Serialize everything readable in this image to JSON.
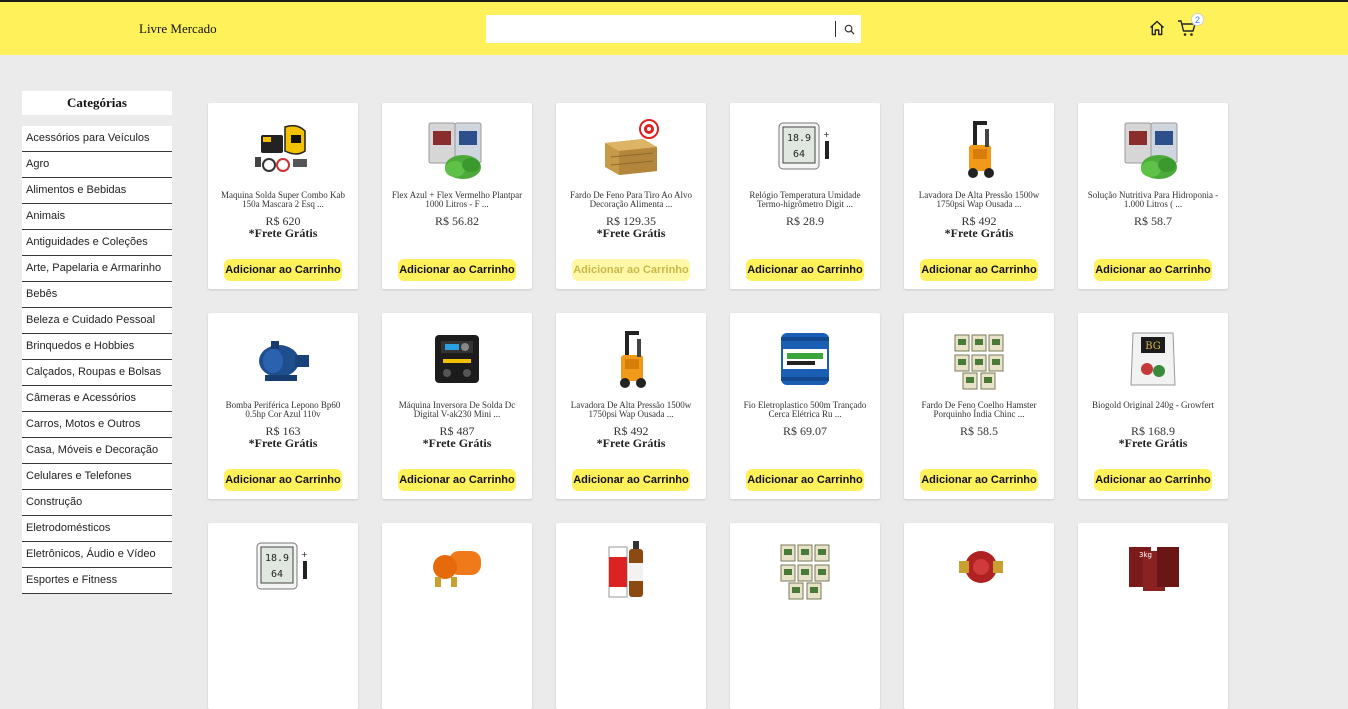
{
  "header": {
    "brand": "Livre Mercado",
    "search": {
      "value": "",
      "placeholder": ""
    },
    "cart_count": "2",
    "icons": {
      "home": "home-icon",
      "cart": "cart-icon",
      "search": "search-icon"
    },
    "colors": {
      "header_bg": "#fff159",
      "button_bg": "#fff159",
      "badge_text": "#3483fa"
    }
  },
  "sidebar": {
    "title": "Categórias",
    "items": [
      "Acessórios para Veículos",
      "Agro",
      "Alimentos e Bebidas",
      "Animais",
      "Antiguidades e Coleções",
      "Arte, Papelaria e Armarinho",
      "Bebês",
      "Beleza e Cuidado Pessoal",
      "Brinquedos e Hobbies",
      "Calçados, Roupas e Bolsas",
      "Câmeras e Acessórios",
      "Carros, Motos e Outros",
      "Casa, Móveis e Decoração",
      "Celulares e Telefones",
      "Construção",
      "Eletrodomésticos",
      "Eletrônicos, Áudio e Vídeo",
      "Esportes e Fitness"
    ]
  },
  "products": [
    {
      "image": "welding-kit-image",
      "title": "Maquina Solda Super Combo Kab 150a Mascara 2 Esq ...",
      "price": "R$ 620",
      "shipping": "*Frete Grátis",
      "button": "Adicionar ao Carrinho",
      "button_disabled": false
    },
    {
      "image": "fertilizer-bags-image",
      "title": "Flex Azul + Flex Vermelho Plantpar 1000 Litros - F ...",
      "price": "R$ 56.82",
      "shipping": "",
      "button": "Adicionar ao Carrinho",
      "button_disabled": false
    },
    {
      "image": "hay-bale-target-image",
      "title": "Fardo De Feno Para Tiro Ao Alvo Decoração Alimenta ...",
      "price": "R$ 129.35",
      "shipping": "*Frete Grátis",
      "button": "Adicionar ao Carrinho",
      "button_disabled": true
    },
    {
      "image": "thermo-hygrometer-image",
      "title": "Relógio Temperatura Umidade Termo-higrômetro Digit ...",
      "price": "R$ 28.9",
      "shipping": "",
      "button": "Adicionar ao Carrinho",
      "button_disabled": false
    },
    {
      "image": "pressure-washer-image",
      "title": "Lavadora De Alta Pressão 1500w 1750psi Wap Ousada ...",
      "price": "R$ 492",
      "shipping": "*Frete Grátis",
      "button": "Adicionar ao Carrinho",
      "button_disabled": false
    },
    {
      "image": "fertilizer-bags-image",
      "title": "Solução Nutritiva Para Hidroponia - 1.000 Litros ( ...",
      "price": "R$ 58.7",
      "shipping": "",
      "button": "Adicionar ao Carrinho",
      "button_disabled": false
    },
    {
      "image": "water-pump-image",
      "title": "Bomba Periférica Lepono Bp60 0.5hp Cor Azul 110v",
      "price": "R$ 163",
      "shipping": "*Frete Grátis",
      "button": "Adicionar ao Carrinho",
      "button_disabled": false
    },
    {
      "image": "inverter-welder-image",
      "title": "Máquina Inversora De Solda Dc Digital V-ak230 Mini ...",
      "price": "R$ 487",
      "shipping": "*Frete Grátis",
      "button": "Adicionar ao Carrinho",
      "button_disabled": false
    },
    {
      "image": "pressure-washer-image",
      "title": "Lavadora De Alta Pressão 1500w 1750psi Wap Ousada ...",
      "price": "R$ 492",
      "shipping": "*Frete Grátis",
      "button": "Adicionar ao Carrinho",
      "button_disabled": false
    },
    {
      "image": "wire-spool-image",
      "title": "Fio Eletroplastico 500m Trançado Cerca Elétrica Ru ...",
      "price": "R$ 69.07",
      "shipping": "",
      "button": "Adicionar ao Carrinho",
      "button_disabled": false
    },
    {
      "image": "hay-packs-image",
      "title": "Fardo De Feno Coelho Hamster Porquinho Índia Chinc ...",
      "price": "R$ 58.5",
      "shipping": "",
      "button": "Adicionar ao Carrinho",
      "button_disabled": false
    },
    {
      "image": "biogold-bag-image",
      "title": "Biogold Original 240g - Growfert",
      "price": "R$ 168.9",
      "shipping": "*Frete Grátis",
      "button": "Adicionar ao Carrinho",
      "button_disabled": false
    },
    {
      "image": "thermo-hygrometer-image",
      "title": "",
      "price": "",
      "shipping": "",
      "button": "",
      "button_disabled": false
    },
    {
      "image": "booster-pump-image",
      "title": "",
      "price": "",
      "shipping": "",
      "button": "",
      "button_disabled": false
    },
    {
      "image": "medicine-bottle-image",
      "title": "",
      "price": "",
      "shipping": "",
      "button": "",
      "button_disabled": false
    },
    {
      "image": "hay-packs-image",
      "title": "",
      "price": "",
      "shipping": "",
      "button": "",
      "button_disabled": false
    },
    {
      "image": "circulation-pump-image",
      "title": "",
      "price": "",
      "shipping": "",
      "button": "",
      "button_disabled": false
    },
    {
      "image": "seed-bags-image",
      "title": "",
      "price": "",
      "shipping": "",
      "button": "",
      "button_disabled": false
    }
  ]
}
